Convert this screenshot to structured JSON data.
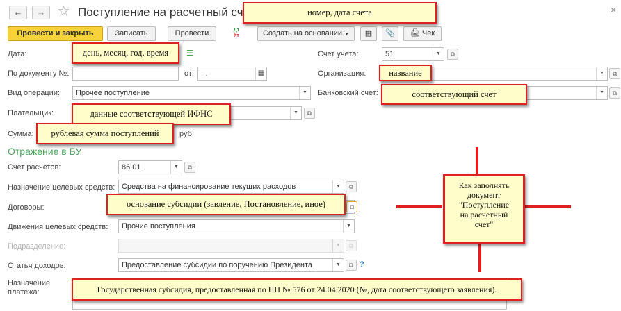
{
  "window": {
    "title": "Поступление на расчетный счет"
  },
  "toolbar": {
    "post_close": "Провести и закрыть",
    "save": "Записать",
    "post": "Провести",
    "dt_kt_top": "Дт",
    "dt_kt_bottom": "Кт",
    "create_based": "Создать на основании",
    "receipt": "Чек"
  },
  "form": {
    "date_label": "Дата:",
    "doc_num_label": "По документу №:",
    "from_label": "от:",
    "from_placeholder": ".  .",
    "op_type_label": "Вид операции:",
    "op_type_value": "Прочее поступление",
    "payer_label": "Плательщик:",
    "sum_label": "Сумма:",
    "currency": "руб.",
    "account_label": "Счет учета:",
    "account_value": "51",
    "org_label": "Организация:",
    "bank_label": "Банковский счет:",
    "section_title": "Отражение в БУ",
    "settle_label": "Счет расчетов:",
    "settle_value": "86.01",
    "purpose_funds_label": "Назначение целевых средств:",
    "purpose_funds_value": "Средства на финансирование текущих расходов",
    "contracts_label": "Договоры:",
    "movement_label": "Движения целевых средств:",
    "movement_value": "Прочие поступления",
    "division_label": "Подразделение:",
    "income_label": "Статья доходов:",
    "income_value": "Предоставление субсидии по поручению Президента",
    "help": "?",
    "payment_purpose_label_1": "Назначение",
    "payment_purpose_label_2": "платежа:"
  },
  "notes": {
    "number_date": "номер, дата счета",
    "date_time": "день, месяц, год, время",
    "name": "название",
    "account": "соответствующий счет",
    "ifns": "данные соответствующей ИФНС",
    "sum": "рублевая сумма поступлений",
    "basis": "основание субсидии (завление, Постановление, иное)",
    "howto": "Как заполнять\nдокумент\n\"Поступление\nна расчетный\nсчет\"",
    "purpose": "Государственная субсидия, предоставленная по ПП № 576 от 24.04.2020 (№, дата соответствующего заявления)."
  },
  "colors": {
    "primary_button": "#f7d23b",
    "section_title": "#4aa35a",
    "note_border": "#e02020",
    "note_bg": "#fffdc9"
  }
}
